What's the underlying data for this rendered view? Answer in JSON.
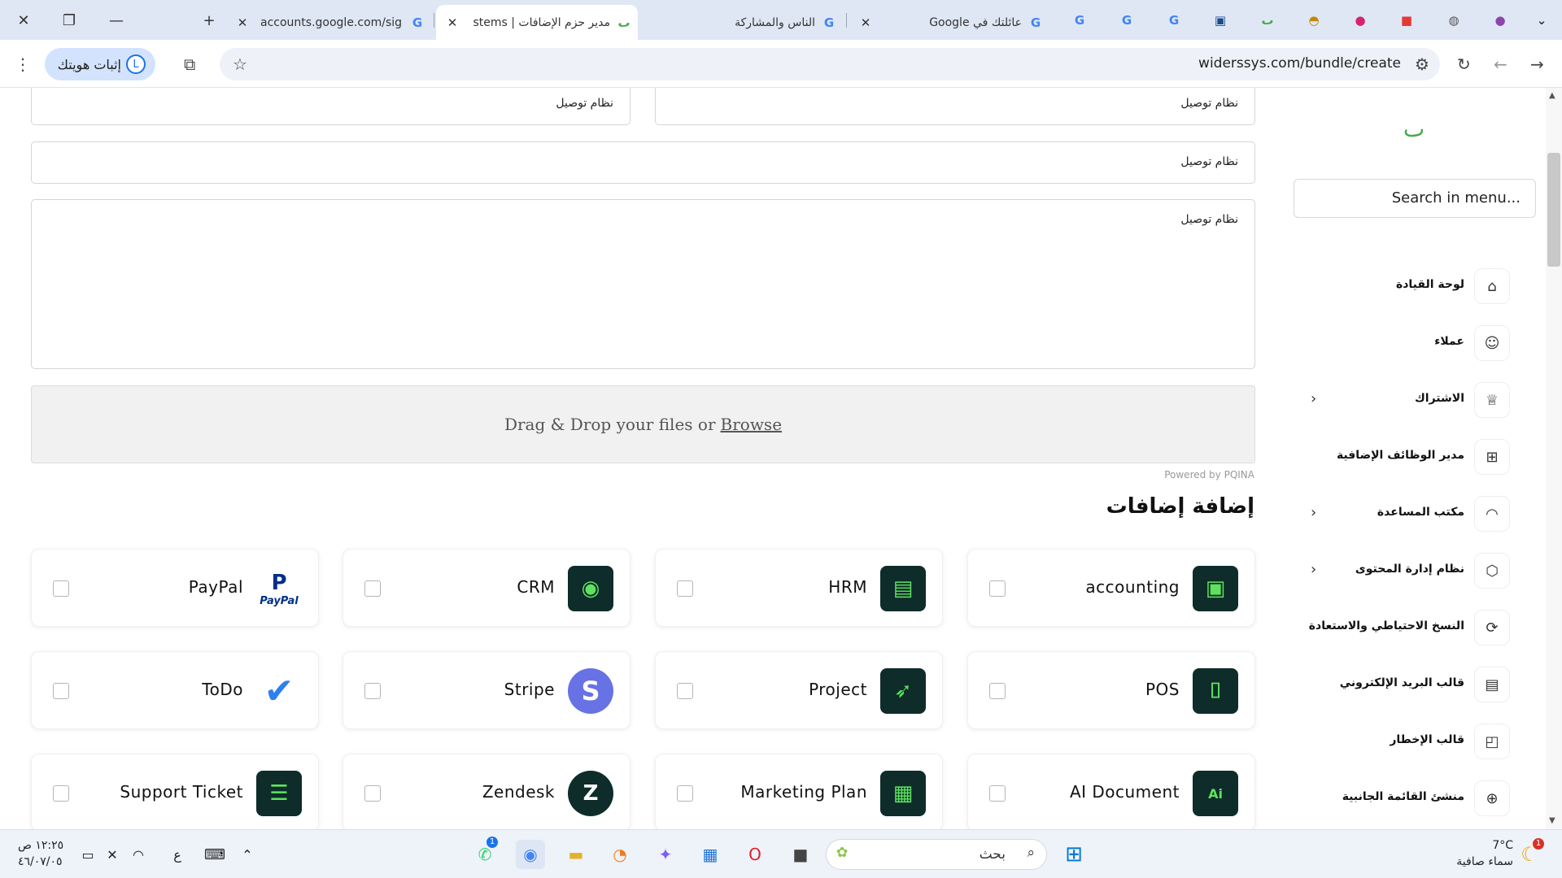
{
  "browser": {
    "tabs": [
      {
        "title": "accounts.google.com/sig",
        "active": false
      },
      {
        "title": "مدير حزم الإضافات | stems",
        "active": true
      },
      {
        "title": "الناس والمشاركة",
        "active": false
      },
      {
        "title": "عائلتك في Google",
        "active": false
      }
    ],
    "url": "widerssys.com/bundle/create",
    "profile_label": "إثبات هويتك",
    "profile_initial": "L",
    "win_close": "✕",
    "win_restore": "❐",
    "win_minimize": "—",
    "new_tab": "+",
    "tab_close": "✕"
  },
  "form": {
    "field_placeholder": "نظام توصيل",
    "drop_text": "Drag & Drop your files or",
    "drop_link": "Browse",
    "powered_by": "Powered by PQINA",
    "section_title": "إضافة إضافات"
  },
  "addons": [
    {
      "name": "accounting",
      "icon": "briefcase-icon"
    },
    {
      "name": "HRM",
      "icon": "id-badge-icon"
    },
    {
      "name": "CRM",
      "icon": "user-eye-icon"
    },
    {
      "name": "PayPal",
      "icon": "paypal-icon",
      "sub": "PayPal"
    },
    {
      "name": "POS",
      "icon": "scan-icon"
    },
    {
      "name": "Project",
      "icon": "rocket-icon"
    },
    {
      "name": "Stripe",
      "icon": "stripe-icon",
      "glyph": "S"
    },
    {
      "name": "ToDo",
      "icon": "checkmark-icon"
    },
    {
      "name": "AI Document",
      "icon": "ai-document-icon",
      "glyph": "Ai"
    },
    {
      "name": "Marketing Plan",
      "icon": "chart-board-icon"
    },
    {
      "name": "Zendesk",
      "icon": "zendesk-icon"
    },
    {
      "name": "Support Ticket",
      "icon": "ticket-icon"
    }
  ],
  "sidebar": {
    "search_placeholder": "Search in menu...",
    "items": [
      {
        "label": "لوحة القيادة",
        "icon": "home-icon",
        "chevron": false
      },
      {
        "label": "عملاء",
        "icon": "users-icon",
        "chevron": false
      },
      {
        "label": "الاشتراك",
        "icon": "trophy-icon",
        "chevron": true
      },
      {
        "label": "مدير الوظائف الإضافية",
        "icon": "grid-icon",
        "chevron": false
      },
      {
        "label": "مكتب المساعدة",
        "icon": "headset-icon",
        "chevron": true
      },
      {
        "label": "نظام إدارة المحتوى",
        "icon": "cube-icon",
        "chevron": true
      },
      {
        "label": "النسخ الاحتياطي والاستعادة",
        "icon": "backup-icon",
        "chevron": false
      },
      {
        "label": "قالب البريد الإلكتروني",
        "icon": "template-icon",
        "chevron": false
      },
      {
        "label": "قالب الإخطار",
        "icon": "notification-icon",
        "chevron": false
      },
      {
        "label": "منشئ القائمة الجانبية",
        "icon": "plus-circle-icon",
        "chevron": false
      }
    ]
  },
  "taskbar": {
    "search_placeholder": "بحث",
    "time": "١٢:٢٥ ص",
    "date": "٤٦/٠٧/٠٥",
    "weather_temp": "7°C",
    "weather_desc": "سماء صافية",
    "lang": "ع",
    "whatsapp_badge": "1",
    "weather_badge": "1"
  }
}
